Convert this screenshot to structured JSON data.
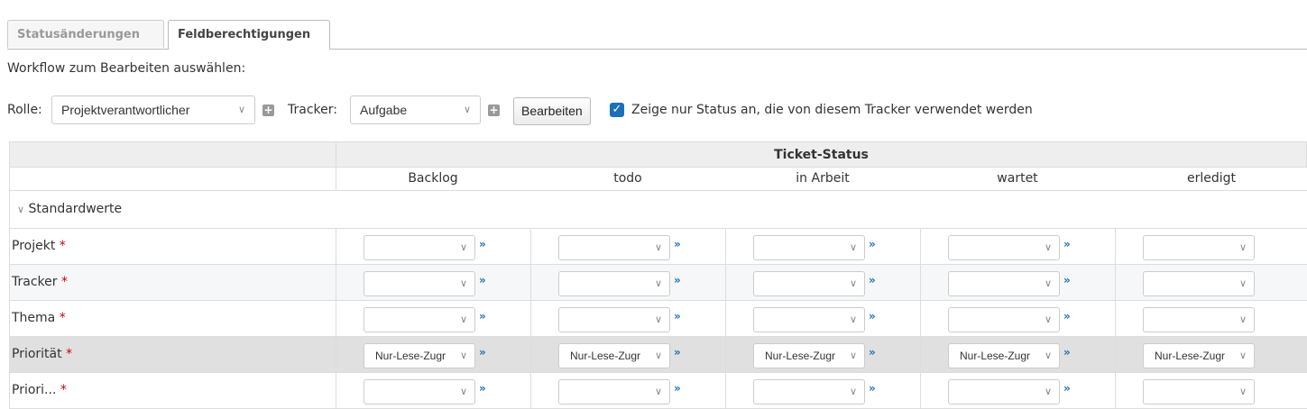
{
  "tabs": [
    {
      "label": "Statusänderungen",
      "active": false
    },
    {
      "label": "Feldberechtigungen",
      "active": true
    }
  ],
  "instruction": "Workflow zum Bearbeiten auswählen:",
  "toolbar": {
    "role_label": "Rolle:",
    "role_value": "Projektverantwortlicher",
    "tracker_label": "Tracker:",
    "tracker_value": "Aufgabe",
    "edit_button": "Bearbeiten",
    "only_used_statuses_checked": true,
    "only_used_statuses_label": "Zeige nur Status an, die von diesem Tracker verwendet werden"
  },
  "table": {
    "header": "Ticket-Status",
    "statuses": [
      "Backlog",
      "todo",
      "in Arbeit",
      "wartet",
      "erledigt"
    ],
    "group_label": "Standardwerte",
    "required_marker": "*",
    "readonly_value": "Nur-Lese-Zugr",
    "fields": [
      {
        "name": "Projekt",
        "required": true,
        "value": ""
      },
      {
        "name": "Tracker",
        "required": true,
        "value": ""
      },
      {
        "name": "Thema",
        "required": true,
        "value": ""
      },
      {
        "name": "Priorität",
        "required": true,
        "value": "Nur-Lese-Zugr"
      },
      {
        "name": "Priori...",
        "required": true,
        "value": ""
      }
    ]
  },
  "colors": {
    "accent": "#1c70b8",
    "required": "#cc0000",
    "header_bg": "#eeeeee",
    "readonly_row_bg": "#e0e0e0"
  }
}
